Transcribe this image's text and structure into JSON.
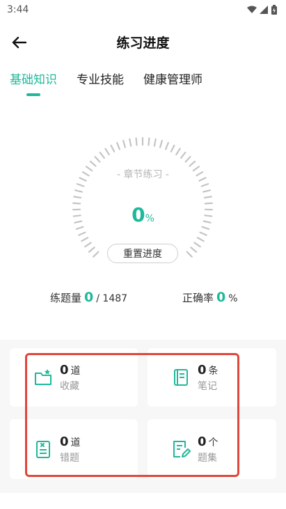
{
  "status_bar": {
    "time": "3:44"
  },
  "header": {
    "title": "练习进度"
  },
  "tabs": [
    {
      "label": "基础知识"
    },
    {
      "label": "专业技能"
    },
    {
      "label": "健康管理师"
    }
  ],
  "gauge": {
    "label": "- 章节练习 -",
    "value": "0",
    "unit": "%"
  },
  "reset_button": "重置进度",
  "stats": {
    "count_label": "练题量",
    "count_value": "0",
    "count_total": "/ 1487",
    "accuracy_label": "正确率",
    "accuracy_value": "0",
    "accuracy_unit": "%"
  },
  "cards": [
    {
      "num": "0",
      "unit": "道",
      "label": "收藏",
      "icon": "folder-star-icon"
    },
    {
      "num": "0",
      "unit": "条",
      "label": "笔记",
      "icon": "notebook-icon"
    },
    {
      "num": "0",
      "unit": "道",
      "label": "错题",
      "icon": "wrong-list-icon"
    },
    {
      "num": "0",
      "unit": "个",
      "label": "题集",
      "icon": "edit-document-icon"
    }
  ],
  "colors": {
    "accent": "#1fb89a",
    "highlight": "#e0463a"
  }
}
